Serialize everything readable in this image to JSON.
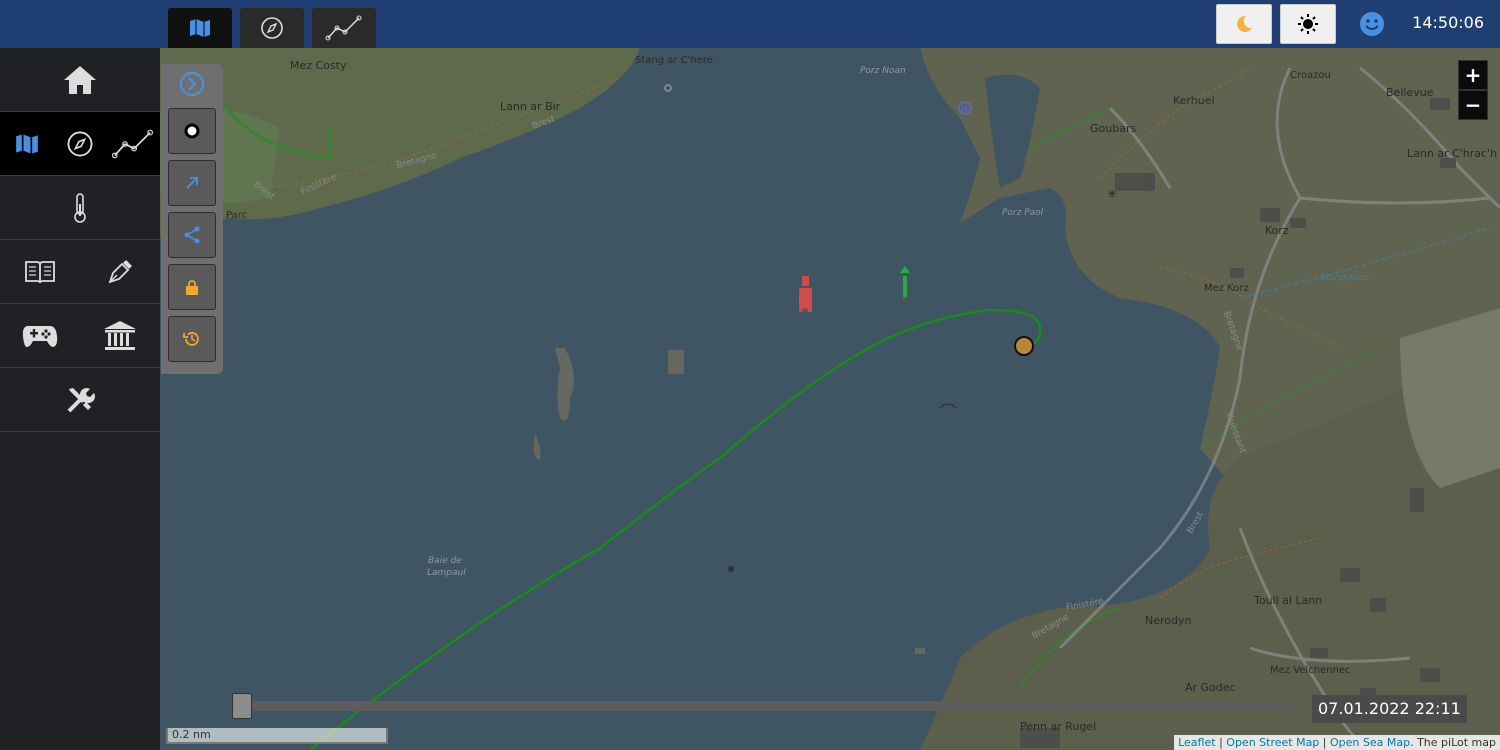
{
  "topbar": {
    "tabs": [
      {
        "name": "map",
        "icon": "map-icon",
        "active": true
      },
      {
        "name": "compass",
        "icon": "compass-icon",
        "active": false
      },
      {
        "name": "track",
        "icon": "chart-line-icon",
        "active": false
      }
    ],
    "theme_buttons": [
      {
        "name": "dark",
        "icon": "moon-icon"
      },
      {
        "name": "light",
        "icon": "sun-icon"
      }
    ],
    "user_icon": "smiley-icon",
    "clock": "14:50:06"
  },
  "sidebar": {
    "rows": [
      {
        "icons": [
          "home-icon"
        ]
      },
      {
        "icons": [
          "map-icon",
          "compass-icon",
          "chart-line-icon"
        ],
        "active": true
      },
      {
        "icons": [
          "thermometer-icon"
        ]
      },
      {
        "icons": [
          "logbook-icon",
          "pen-icon"
        ]
      },
      {
        "icons": [
          "gamepad-icon",
          "bank-icon"
        ]
      },
      {
        "icons": [
          "tools-icon"
        ]
      }
    ]
  },
  "map_tools": [
    {
      "name": "expand",
      "icon": "chevron-right-circle-icon"
    },
    {
      "name": "center",
      "icon": "position-dot-icon"
    },
    {
      "name": "heading",
      "icon": "arrow-up-right-icon"
    },
    {
      "name": "share",
      "icon": "share-icon"
    },
    {
      "name": "lock",
      "icon": "lock-icon"
    },
    {
      "name": "history",
      "icon": "history-icon"
    }
  ],
  "map": {
    "labels": {
      "mez_costy": "Mez Costy",
      "stang_ar_chere": "Stang ar C'here",
      "porz_noan": "Porz Noan",
      "kerhuel": "Kerhuel",
      "croazou": "Croazou",
      "bellevue": "Bellevue",
      "lann_ar_bir": "Lann ar Bir",
      "goubars": "Goubars",
      "lann_ar_chrach": "Lann ar C'hrac'h",
      "porz_paol": "Porz Paol",
      "korz": "Korz",
      "mez_korz": "Mez Korz",
      "stang_korz": "Stang Korz",
      "baie_de_lampaul_1": "Baie de",
      "baie_de_lampaul_2": "Lampaul",
      "toull_al_lann": "Toull al Lann",
      "nerodyn": "Nerodyn",
      "mez_velchennec": "Mez Velchennec",
      "ar_godec": "Ar Godec",
      "penn_ar_rugel": "Penn ar Rugel",
      "parc": "Parc",
      "brest_1": "Brest",
      "bretagne_1": "Bretagne",
      "brest_2": "Brest",
      "finistere": "Finistère",
      "bretagne_2": "Bretagne",
      "ouessant": "Ouessant",
      "brest_3": "Brest",
      "finistere_2": "Finistère",
      "bretagne_3": "Bretagne"
    }
  },
  "zoom": {
    "in": "+",
    "out": "−"
  },
  "timeline": {
    "position": 0.0,
    "time": "07.01.2022 22:11"
  },
  "scale": "0.2 nm",
  "attribution": {
    "leaflet": "Leaflet",
    "sep1": "|",
    "osm": "Open Street Map",
    "sep2": "|",
    "osm_sea": "Open Sea Map",
    "suffix": ". The piLot map"
  },
  "colors": {
    "topbar": "#1f3f73",
    "sidebar": "#1f2124",
    "water": "#3f5563",
    "land": "#5b5f4c",
    "track": "#1a8a1a",
    "boat": "#b8863a",
    "accent_blue": "#4a90e2",
    "accent_orange": "#f0a830"
  }
}
